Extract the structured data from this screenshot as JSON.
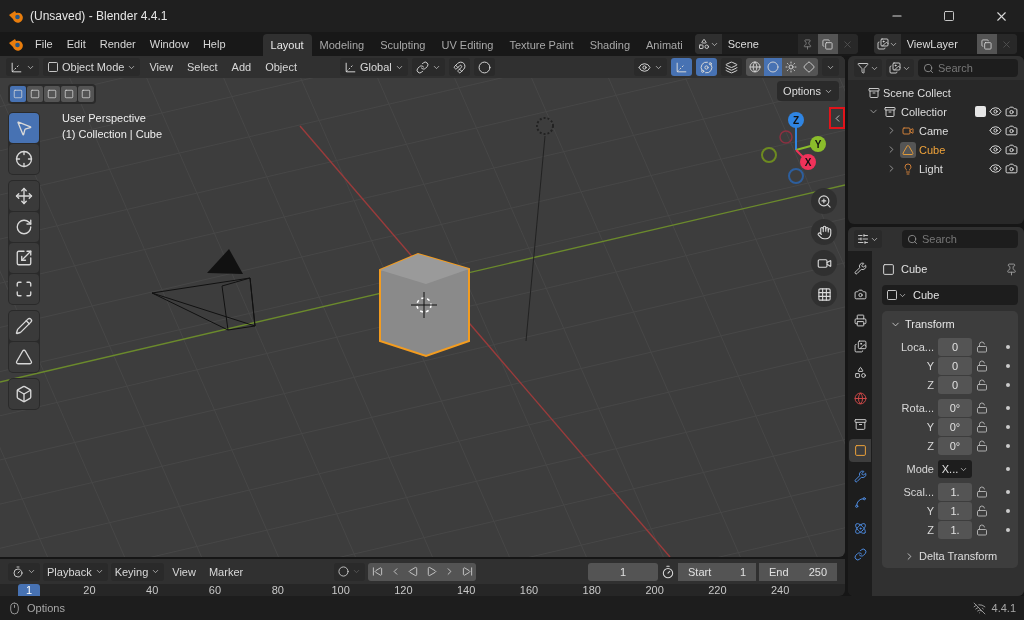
{
  "window": {
    "title": "(Unsaved) - Blender 4.4.1"
  },
  "menu": [
    "File",
    "Edit",
    "Render",
    "Window",
    "Help"
  ],
  "workspaces": [
    {
      "label": "Layout",
      "selected": true
    },
    {
      "label": "Modeling",
      "selected": false
    },
    {
      "label": "Sculpting",
      "selected": false
    },
    {
      "label": "UV Editing",
      "selected": false
    },
    {
      "label": "Texture Paint",
      "selected": false
    },
    {
      "label": "Shading",
      "selected": false
    },
    {
      "label": "Animati",
      "selected": false
    }
  ],
  "scene": {
    "name": "Scene"
  },
  "view_layer": {
    "name": "ViewLayer"
  },
  "viewport": {
    "mode": "Object Mode",
    "menus": [
      "View",
      "Select",
      "Add",
      "Object"
    ],
    "orientation": "Global",
    "options": "Options",
    "overlay_lines": [
      "User Perspective",
      "(1) Collection | Cube"
    ],
    "select_modes": [
      {
        "selected": true
      },
      {
        "selected": false
      },
      {
        "selected": false
      },
      {
        "selected": false
      },
      {
        "selected": false
      }
    ],
    "toggles": [
      {
        "kind": "snap",
        "on": false
      },
      {
        "kind": "proportional",
        "on": false
      },
      {
        "kind": "gizmo",
        "on": true
      },
      {
        "kind": "overlay",
        "on": true
      },
      {
        "kind": "xray",
        "on": false
      }
    ],
    "shading": [
      {
        "kind": "wireframe",
        "selected": false
      },
      {
        "kind": "solid",
        "selected": true
      },
      {
        "kind": "material",
        "selected": false
      },
      {
        "kind": "rendered",
        "selected": false
      }
    ],
    "tool_groups": [
      [
        {
          "kind": "select",
          "selected": true
        },
        {
          "kind": "cursor",
          "selected": false
        }
      ],
      [
        {
          "kind": "move",
          "selected": false
        },
        {
          "kind": "rotate",
          "selected": false
        },
        {
          "kind": "scale",
          "selected": false
        },
        {
          "kind": "transform",
          "selected": false
        }
      ],
      [
        {
          "kind": "annotate",
          "selected": false
        },
        {
          "kind": "measure",
          "selected": false
        }
      ],
      [
        {
          "kind": "add_cube",
          "selected": false
        }
      ]
    ],
    "gizmo": [
      {
        "label": "Z",
        "color": "#2f85e3"
      },
      {
        "label": "Y",
        "color": "#8bbd2b"
      },
      {
        "label": "X",
        "color": "#f0325a"
      }
    ],
    "sidebar_toggle": {
      "highlighted": true
    }
  },
  "outliner": {
    "search_placeholder": "Search",
    "root": "Scene Collect",
    "tree": [
      {
        "label": "Collectior",
        "kind": "collection",
        "expanded": true,
        "checked": true,
        "selected": false,
        "children": [
          {
            "label": "Came",
            "kind": "camera",
            "expanded": false,
            "selected": false
          },
          {
            "label": "Cube",
            "kind": "mesh",
            "expanded": false,
            "selected": true
          },
          {
            "label": "Light",
            "kind": "light",
            "expanded": false,
            "selected": false
          }
        ]
      }
    ]
  },
  "properties": {
    "search_placeholder": "Search",
    "tabs": [
      {
        "kind": "tool",
        "selected": false
      },
      {
        "kind": "render",
        "selected": false
      },
      {
        "kind": "output",
        "selected": false
      },
      {
        "kind": "view_layer",
        "selected": false
      },
      {
        "kind": "scene",
        "selected": false
      },
      {
        "kind": "world",
        "selected": false
      },
      {
        "kind": "collection",
        "selected": false
      },
      {
        "kind": "object",
        "selected": true
      },
      {
        "kind": "modifiers",
        "selected": false
      },
      {
        "kind": "particles",
        "selected": false
      },
      {
        "kind": "physics",
        "selected": false
      },
      {
        "kind": "constraints",
        "selected": false
      }
    ],
    "object_name": "Cube",
    "data_name": "Cube",
    "panel": {
      "title": "Transform",
      "expanded": true,
      "groups": [
        [
          {
            "label": "Loca...",
            "value": "0",
            "kind": "field"
          },
          {
            "label": "Y",
            "value": "0",
            "kind": "field"
          },
          {
            "label": "Z",
            "value": "0",
            "kind": "field"
          }
        ],
        [
          {
            "label": "Rota...",
            "value": "0°",
            "kind": "field"
          },
          {
            "label": "Y",
            "value": "0°",
            "kind": "field"
          },
          {
            "label": "Z",
            "value": "0°",
            "kind": "field"
          }
        ],
        [
          {
            "label": "Mode",
            "value": "X...",
            "kind": "dropdown"
          }
        ],
        [
          {
            "label": "Scal...",
            "value": "1.",
            "kind": "field"
          },
          {
            "label": "Y",
            "value": "1.",
            "kind": "field"
          },
          {
            "label": "Z",
            "value": "1.",
            "kind": "field"
          }
        ]
      ]
    },
    "subpanel": {
      "title": "Delta Transform",
      "expanded": false
    }
  },
  "timeline": {
    "menus": [
      "Playback",
      "Keying",
      "View",
      "Marker"
    ],
    "current_frame": "1",
    "start_label": "Start",
    "start": "1",
    "end_label": "End",
    "end": "250",
    "playhead": "1",
    "ruler": [
      "20",
      "40",
      "60",
      "80",
      "100",
      "120",
      "140",
      "160",
      "180",
      "200",
      "220",
      "240"
    ]
  },
  "status_bar": {
    "hint": "Options",
    "version": "4.4.1"
  }
}
